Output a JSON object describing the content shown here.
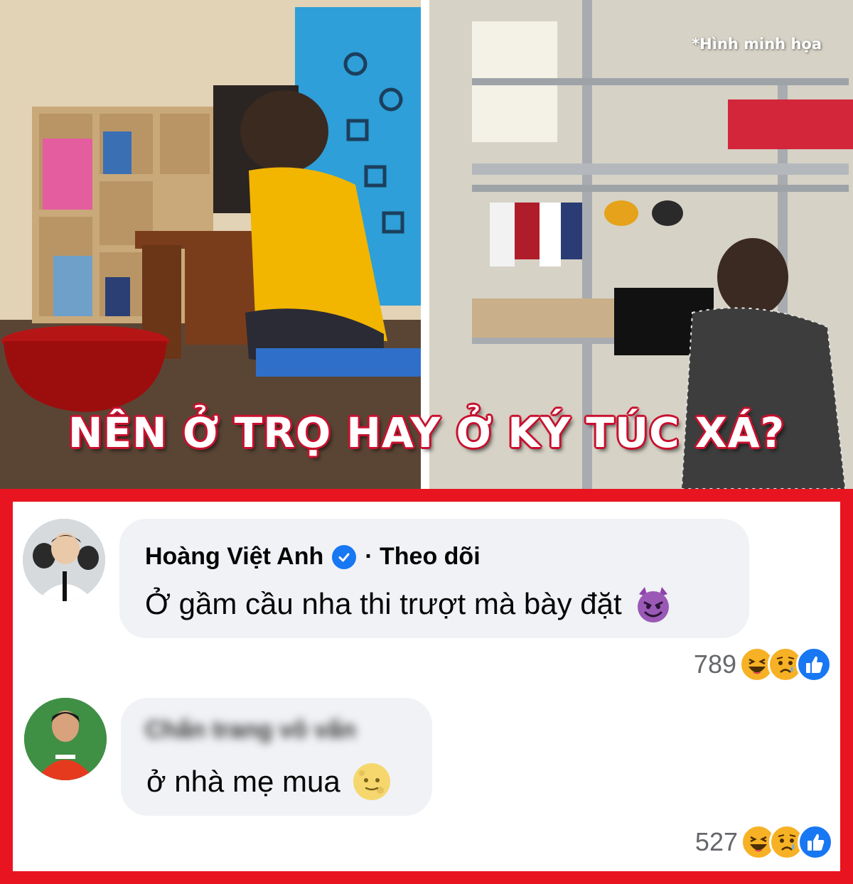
{
  "banner": {
    "title": "NÊN Ở TRỌ HAY Ở KÝ TÚC XÁ?",
    "note": "*Hình minh họa"
  },
  "comments": [
    {
      "author": "Hoàng Việt Anh",
      "verified": true,
      "follow_label": "· Theo dõi",
      "text": "Ở gầm cầu nha thi trượt mà bày đặt",
      "emoji": "devil-smile-icon",
      "reaction_count": "789",
      "reactions": [
        "haha-icon",
        "sad-icon",
        "like-icon"
      ]
    },
    {
      "author": "Chấn trang vô vấn",
      "author_blurred": true,
      "text": "ở nhà mẹ mua",
      "emoji": "moon-face-icon",
      "reaction_count": "527",
      "reactions": [
        "haha-icon",
        "sad-icon",
        "like-icon"
      ]
    }
  ],
  "colors": {
    "frame": "#e8141f",
    "title_outline": "#c8102e",
    "bubble": "#f0f2f5",
    "verified": "#1877f2",
    "muted_text": "#65676b"
  }
}
